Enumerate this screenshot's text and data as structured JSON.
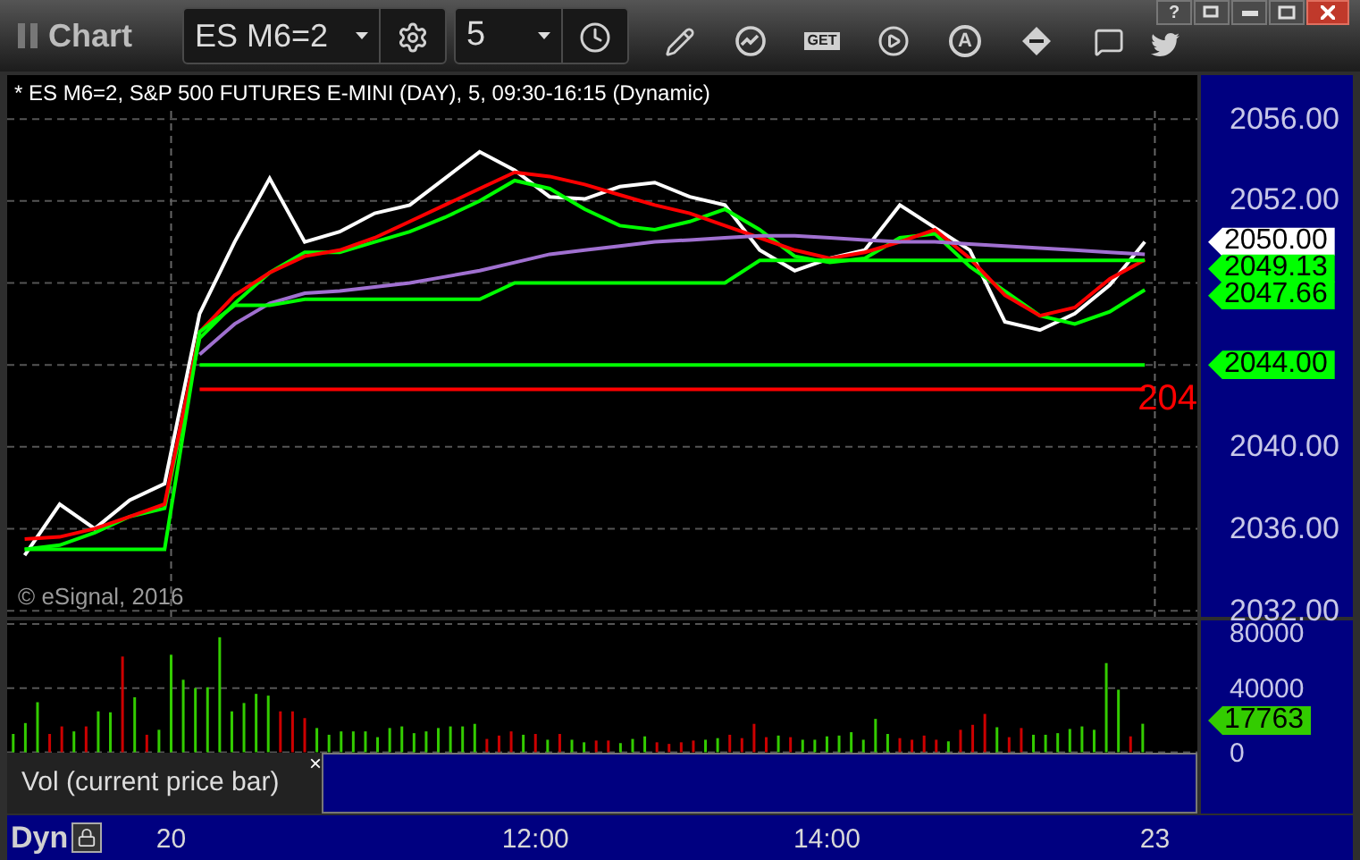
{
  "toolbar": {
    "title": "Chart",
    "symbol": "ES M6=2",
    "interval": "5",
    "get_icon_text": "GET",
    "alert_icon_text": "A"
  },
  "window_controls": {
    "help": "?"
  },
  "chart": {
    "header": "* ES M6=2, S&P 500 FUTURES E-MINI (DAY), 5, 09:30-16:15 (Dynamic)",
    "copyright": "© eSignal, 2016",
    "level_label": "204",
    "chart_data": {
      "type": "line",
      "grid": true,
      "categories": [
        null,
        null,
        null,
        null,
        null,
        null,
        null,
        null,
        null,
        null,
        null,
        null,
        null,
        null,
        null,
        null,
        null,
        null,
        null,
        null,
        null,
        null,
        null,
        null,
        null,
        null,
        null,
        null,
        null,
        null,
        null,
        null,
        null,
        null
      ],
      "ylim": [
        2031.7,
        2056.4
      ],
      "yticks": [
        {
          "value": 2032,
          "label": "2032.00"
        },
        {
          "value": 2036,
          "label": "2036.00"
        },
        {
          "value": 2040,
          "label": "2040.00"
        },
        {
          "value": 2052,
          "label": "2052.00"
        },
        {
          "value": 2056,
          "label": "2056.00"
        }
      ],
      "series": [
        {
          "color": "#ffffff",
          "values": [
            2034.7,
            2037.2,
            2036.0,
            2037.4,
            2038.2,
            2046.5,
            2050.0,
            2053.1,
            2050.0,
            2050.5,
            2051.4,
            2051.8,
            2053.1,
            2054.4,
            2053.5,
            2052.2,
            2052.1,
            2052.7,
            2052.9,
            2052.2,
            2051.8,
            2049.6,
            2048.6,
            2049.2,
            2049.6,
            2051.8,
            2050.7,
            2049.6,
            2046.1,
            2045.7,
            2046.5,
            2047.9,
            2050.0,
            null
          ]
        },
        {
          "color": "#00ff00",
          "values": [
            2035.0,
            2035.2,
            2035.8,
            2036.6,
            2037.0,
            2045.3,
            2047.0,
            2048.5,
            2049.5,
            2049.5,
            2050.0,
            2050.5,
            2051.2,
            2052.0,
            2053.0,
            2052.6,
            2051.6,
            2050.8,
            2050.6,
            2051.0,
            2051.6,
            2050.6,
            2049.3,
            2049.0,
            2049.2,
            2050.2,
            2050.4,
            2048.8,
            2047.6,
            2046.4,
            2046.0,
            2046.6,
            2047.66,
            null
          ]
        },
        {
          "color": "#ff0000",
          "values": [
            2035.5,
            2035.6,
            2036.0,
            2036.6,
            2037.2,
            2045.6,
            2047.4,
            2048.5,
            2049.3,
            2049.6,
            2050.2,
            2051.0,
            2051.8,
            2052.6,
            2053.4,
            2053.2,
            2052.8,
            2052.3,
            2051.8,
            2051.4,
            2050.8,
            2050.2,
            2049.6,
            2049.2,
            2049.5,
            2050.0,
            2050.6,
            2049.2,
            2047.4,
            2046.4,
            2046.8,
            2048.2,
            2049.13,
            null
          ]
        },
        {
          "color": "#a070d0",
          "values": [
            null,
            null,
            null,
            null,
            null,
            2044.5,
            2046.0,
            2047.0,
            2047.5,
            2047.6,
            2047.8,
            2048.0,
            2048.3,
            2048.6,
            2049.0,
            2049.4,
            2049.6,
            2049.8,
            2050.0,
            2050.1,
            2050.2,
            2050.3,
            2050.3,
            2050.2,
            2050.1,
            2050.0,
            2050.0,
            2049.9,
            2049.8,
            2049.7,
            2049.6,
            2049.5,
            2049.4,
            null
          ]
        },
        {
          "color": "#00ff00",
          "values": [
            2035.0,
            2035.0,
            2035.0,
            2035.0,
            2035.0,
            2045.6,
            2046.9,
            2046.9,
            2047.2,
            2047.2,
            2047.2,
            2047.2,
            2047.2,
            2047.2,
            2048.0,
            2048.0,
            2048.0,
            2048.0,
            2048.0,
            2048.0,
            2048.0,
            2049.1,
            2049.1,
            2049.1,
            2049.1,
            2049.1,
            2049.1,
            2049.1,
            2049.1,
            2049.1,
            2049.1,
            2049.1,
            2049.1,
            null
          ]
        },
        {
          "color": "#00ff00",
          "values": [
            null,
            null,
            null,
            null,
            null,
            2044,
            2044,
            2044,
            2044,
            2044,
            2044,
            2044,
            2044,
            2044,
            2044,
            2044,
            2044,
            2044,
            2044,
            2044,
            2044,
            2044,
            2044,
            2044,
            2044,
            2044,
            2044,
            2044,
            2044,
            2044,
            2044,
            2044,
            2044,
            null
          ]
        },
        {
          "color": "#ff0000",
          "values": [
            null,
            null,
            null,
            null,
            null,
            2042.8,
            2042.8,
            2042.8,
            2042.8,
            2042.8,
            2042.8,
            2042.8,
            2042.8,
            2042.8,
            2042.8,
            2042.8,
            2042.8,
            2042.8,
            2042.8,
            2042.8,
            2042.8,
            2042.8,
            2042.8,
            2042.8,
            2042.8,
            2042.8,
            2042.8,
            2042.8,
            2042.8,
            2042.8,
            2042.8,
            2042.8,
            2042.8,
            null
          ]
        }
      ],
      "annotations": [
        "2050.00",
        "2049.13",
        "2047.66",
        "2044.00"
      ]
    }
  },
  "price_axis": {
    "tags": [
      {
        "color": "#ffffff"
      },
      {
        "color": "#00ff00"
      },
      {
        "color": "#00ff00"
      },
      {
        "color": "#00ff00"
      }
    ]
  },
  "volume": {
    "chart_data": {
      "type": "bar",
      "grid": true,
      "ylim": [
        -300,
        82200
      ],
      "yticks": [
        {
          "value": 0,
          "label": "0"
        },
        {
          "value": 40000,
          "label": "40000"
        },
        {
          "value": 80000,
          "label": "80000"
        }
      ],
      "categories": [
        null,
        null,
        null,
        null,
        null,
        null,
        null,
        null,
        null,
        null,
        null,
        null,
        null,
        "20",
        null,
        null,
        null,
        null,
        null,
        null,
        null,
        null,
        null,
        null,
        null,
        null,
        null,
        null,
        null,
        null,
        null,
        null,
        null,
        null,
        null,
        null,
        null,
        null,
        null,
        null,
        null,
        null,
        null,
        "12:00",
        null,
        null,
        null,
        null,
        null,
        null,
        null,
        null,
        null,
        null,
        null,
        null,
        null,
        null,
        null,
        null,
        null,
        null,
        null,
        null,
        null,
        null,
        null,
        "14:00",
        null,
        null,
        null,
        null,
        null,
        null,
        null,
        null,
        null,
        null,
        null,
        null,
        null,
        null,
        null,
        null,
        null,
        null,
        null,
        null,
        null,
        null,
        null,
        null,
        null,
        null,
        "23",
        null,
        null,
        null
      ],
      "series": [
        {
          "color": "#33cc00",
          "values": [
            11400,
            18200,
            31200,
            null,
            null,
            13000,
            null,
            25500,
            24900,
            null,
            34300,
            null,
            14000,
            60800,
            45200,
            40000,
            40500,
            71700,
            25500,
            30700,
            36400,
            35300,
            null,
            null,
            null,
            15100,
            10900,
            13000,
            13000,
            13000,
            9400,
            15100,
            16100,
            11900,
            13000,
            15100,
            16100,
            16100,
            17700,
            null,
            null,
            null,
            10900,
            null,
            7800,
            null,
            7800,
            6200,
            null,
            null,
            5700,
            8300,
            9900,
            null,
            null,
            null,
            null,
            7800,
            8800,
            null,
            null,
            null,
            null,
            10400,
            null,
            7800,
            7800,
            9900,
            10400,
            12500,
            7800,
            20800,
            11400,
            null,
            null,
            null,
            null,
            6800,
            null,
            null,
            null,
            15600,
            null,
            null,
            10900,
            10900,
            11900,
            14500,
            16100,
            14000,
            55600,
            39000,
            null,
            17763,
            null,
            null,
            null,
            null
          ]
        },
        {
          "color": "#cc0000",
          "values": [
            null,
            null,
            null,
            11400,
            16100,
            null,
            16100,
            null,
            null,
            59700,
            null,
            10900,
            null,
            null,
            null,
            null,
            null,
            null,
            null,
            null,
            null,
            null,
            25500,
            25500,
            21300,
            null,
            null,
            null,
            null,
            null,
            null,
            null,
            null,
            null,
            null,
            null,
            null,
            null,
            null,
            8300,
            10400,
            13000,
            null,
            11400,
            null,
            11400,
            null,
            null,
            7300,
            7300,
            null,
            null,
            null,
            6200,
            5200,
            6200,
            7300,
            null,
            null,
            10900,
            8800,
            17700,
            9400,
            null,
            9400,
            null,
            null,
            null,
            null,
            null,
            null,
            null,
            null,
            8800,
            7800,
            10400,
            7800,
            null,
            14000,
            17100,
            23900,
            null,
            9400,
            15100,
            null,
            null,
            null,
            null,
            null,
            null,
            null,
            null,
            9900,
            null,
            null,
            null,
            null,
            null
          ]
        }
      ],
      "annotations": [
        "17763"
      ]
    }
  },
  "volume_axis": {
    "tags": [
      {
        "color": "#33cc00"
      }
    ]
  },
  "legend": {
    "label": "Vol (current price bar)",
    "close": "×"
  },
  "time_axis": {
    "mode": "Dyn"
  }
}
